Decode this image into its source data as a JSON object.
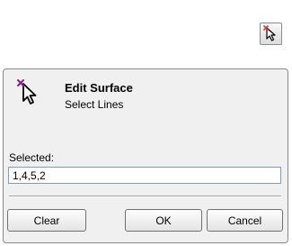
{
  "toolbar": {
    "select_tool_icon": "select-arrow-cursor-icon"
  },
  "panel": {
    "icon": "select-arrow-cursor-icon",
    "title": "Edit Surface",
    "subtitle": "Select Lines",
    "selected_label": "Selected:",
    "selected_value": "1,4,5,2",
    "buttons": {
      "clear": "Clear",
      "ok": "OK",
      "cancel": "Cancel"
    }
  },
  "colors": {
    "cursor_marker": "#8b1a8b",
    "corner_marker": "#d03a3a"
  }
}
